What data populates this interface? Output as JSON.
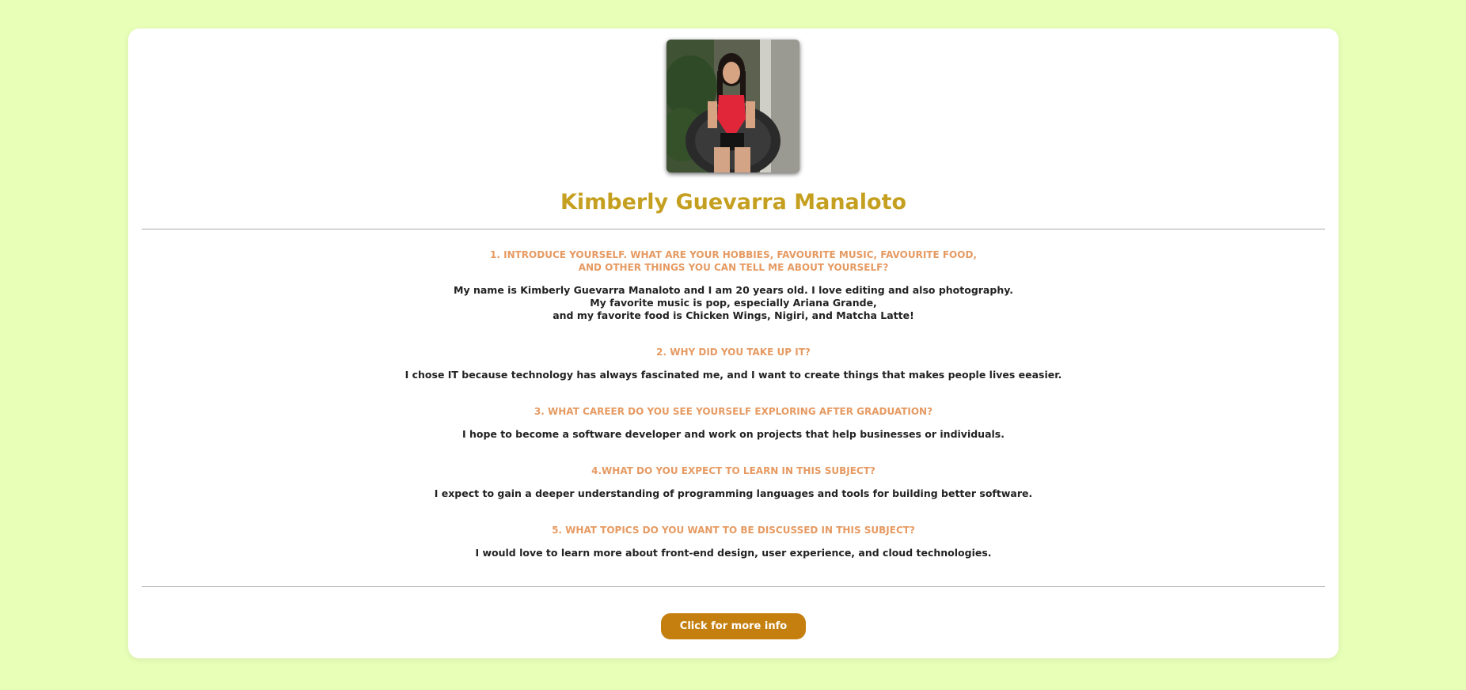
{
  "profile": {
    "name": "Kimberly Guevarra Manaloto",
    "photo": "profile-photo"
  },
  "qa": [
    {
      "question_lines": [
        "1. INTRODUCE YOURSELF. WHAT ARE YOUR HOBBIES, FAVOURITE MUSIC, FAVOURITE FOOD,",
        "AND OTHER THINGS YOU CAN TELL ME ABOUT YOURSELF?"
      ],
      "answer_lines": [
        "My name is Kimberly Guevarra Manaloto and I am 20 years old. I love editing and also photography.",
        "My favorite music is pop, especially Ariana Grande,",
        "and my favorite food is Chicken Wings, Nigiri, and Matcha Latte!"
      ]
    },
    {
      "question_lines": [
        "2. WHY DID YOU TAKE UP IT?"
      ],
      "answer_lines": [
        "I chose IT because technology has always fascinated me, and I want to create things that makes people lives eeasier."
      ]
    },
    {
      "question_lines": [
        "3. WHAT CAREER DO YOU SEE YOURSELF EXPLORING AFTER GRADUATION?"
      ],
      "answer_lines": [
        "I hope to become a software developer and work on projects that help businesses or individuals."
      ]
    },
    {
      "question_lines": [
        "4.WHAT DO YOU EXPECT TO LEARN IN THIS SUBJECT?"
      ],
      "answer_lines": [
        "I expect to gain a deeper understanding of programming languages and tools for building better software."
      ]
    },
    {
      "question_lines": [
        "5. WHAT TOPICS DO YOU WANT TO BE DISCUSSED IN THIS SUBJECT?"
      ],
      "answer_lines": [
        "I would love to learn more about front-end design, user experience, and cloud technologies."
      ]
    }
  ],
  "button": {
    "label": "Click for more info"
  },
  "colors": {
    "background": "#e8ffb8",
    "name": "#c5a020",
    "question": "#e69a62",
    "button": "#c47f0f"
  }
}
